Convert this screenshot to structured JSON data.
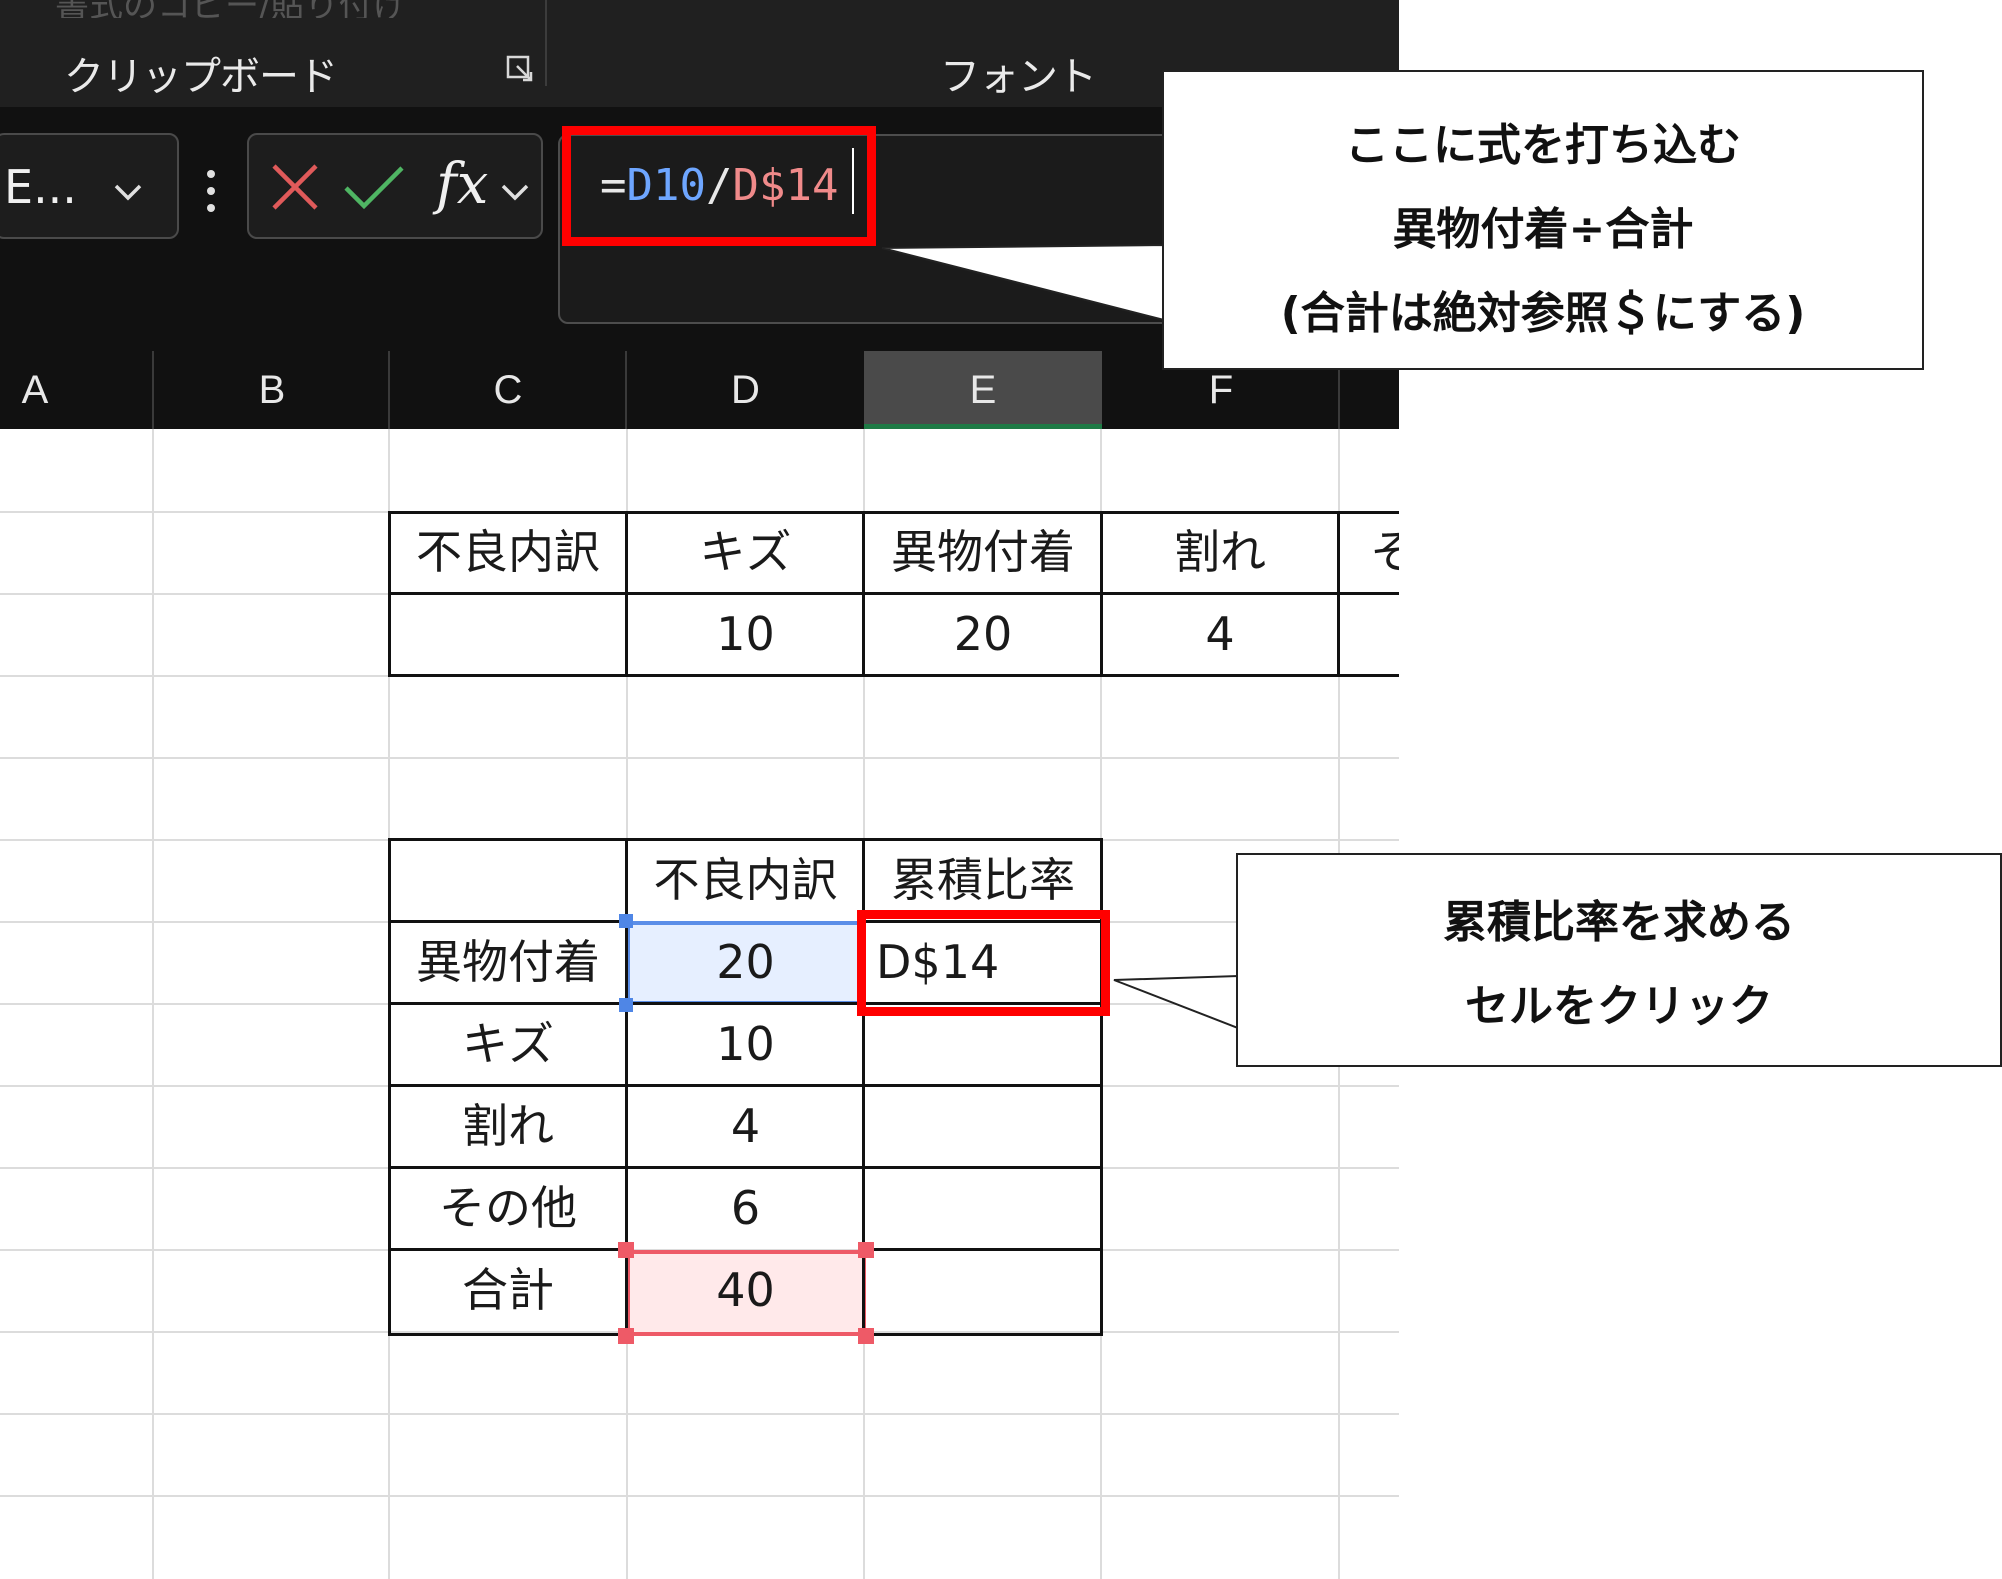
{
  "ribbon": {
    "ghost_label": "書式のコピー/貼り付け",
    "group_clipboard": "クリップボード",
    "group_font": "フォント"
  },
  "formula_bar": {
    "namebox": "E...",
    "fx": "fx",
    "formula": {
      "eq": "=",
      "ref1": "D10",
      "op": "/",
      "ref2": "D$14"
    }
  },
  "columns": [
    "A",
    "B",
    "C",
    "D",
    "E",
    "F"
  ],
  "table1": {
    "headers": [
      "不良内訳",
      "キズ",
      "異物付着",
      "割れ",
      "そ"
    ],
    "values": [
      "",
      "10",
      "20",
      "4",
      ""
    ]
  },
  "table2": {
    "headers": [
      "",
      "不良内訳",
      "累積比率"
    ],
    "rows": [
      {
        "label": "異物付着",
        "value": "20",
        "ratio": "D$14"
      },
      {
        "label": "キズ",
        "value": "10",
        "ratio": ""
      },
      {
        "label": "割れ",
        "value": "4",
        "ratio": ""
      },
      {
        "label": "その他",
        "value": "6",
        "ratio": ""
      },
      {
        "label": "合計",
        "value": "40",
        "ratio": ""
      }
    ]
  },
  "callouts": {
    "formula": [
      "ここに式を打ち込む",
      "異物付着÷合計",
      "(合計は絶対参照＄にする)"
    ],
    "cell": [
      "累積比率を求める",
      "セルをクリック"
    ]
  },
  "colors": {
    "highlight_red": "#ff0000",
    "ref_blue": "#6ea6ff",
    "ref_red": "#f08a8a",
    "dark_bg": "#111111"
  }
}
